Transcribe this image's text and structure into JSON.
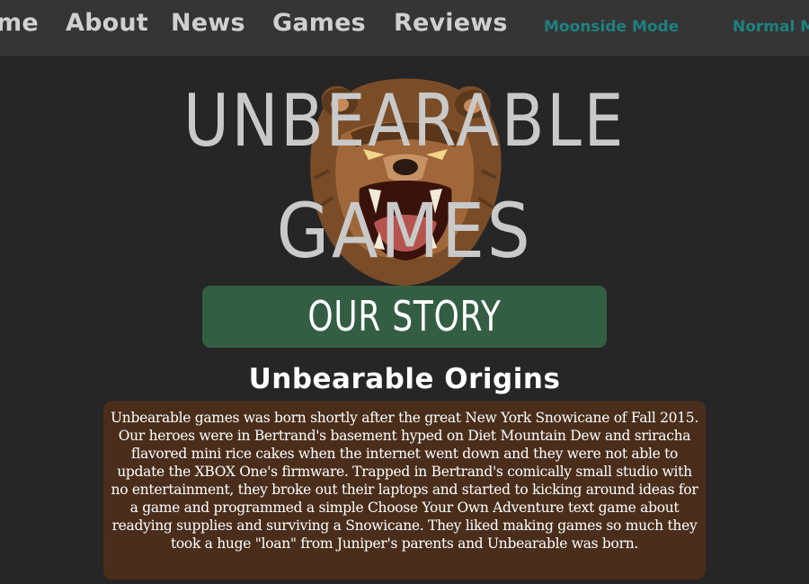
{
  "nav": {
    "links": [
      "me",
      "About",
      "News",
      "Games",
      "Reviews"
    ],
    "modes": [
      "Moonside Mode",
      "Normal M"
    ]
  },
  "hero": {
    "logo_icon": "roaring-bear-icon",
    "title_line_1": "UNBEARABLE",
    "title_line_2": "GAMES"
  },
  "banner": {
    "label": "OUR STORY"
  },
  "section": {
    "heading": "Unbearable Origins",
    "body": "Unbearable games was born shortly after the great New York Snowicane of Fall 2015. Our heroes were in Bertrand's basement hyped on Diet Mountain Dew and sriracha flavored mini rice cakes when the internet went down and they were not able to update the XBOX One's firmware. Trapped in Bertrand's comically small studio with no entertainment, they broke out their laptops and started to kicking around ideas for a game and programmed a simple Choose Your Own Adventure text game about readying supplies and surviving a Snowicane. They liked making games so much they took a huge \"loan\" from Juniper's parents and Unbearable was born."
  },
  "colors": {
    "background": "#262626",
    "navbar": "#353535",
    "nav_text": "#d0d0d0",
    "mode_text": "#1f8080",
    "banner": "#345e43",
    "story_box": "#4a2e1b",
    "title_text": "#c9c9c9"
  }
}
